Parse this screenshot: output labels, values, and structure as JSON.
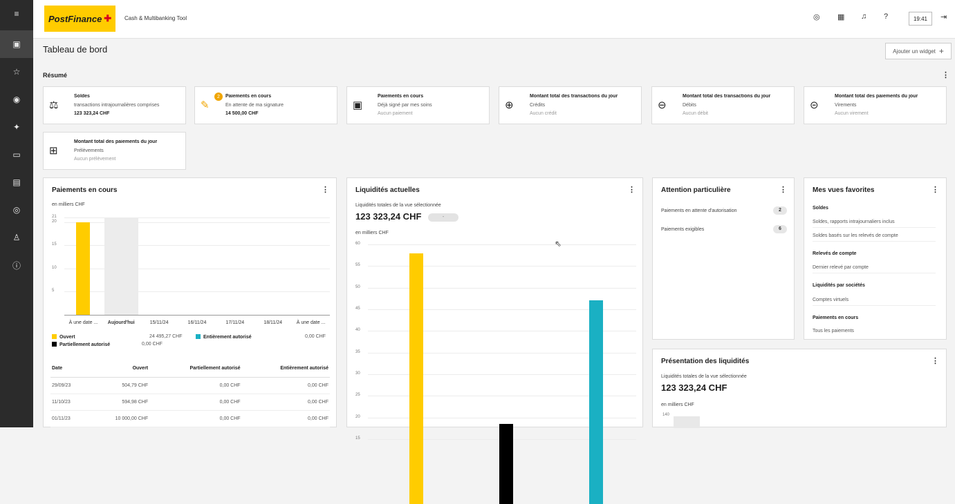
{
  "topbar": {
    "brand": "PostFinance",
    "app_title": "Cash & Multibanking Tool",
    "time": "19:41",
    "icons": [
      "user-circle-icon",
      "calculator-icon",
      "bell-icon",
      "help-icon",
      "logout-icon"
    ]
  },
  "sidebar": {
    "items": [
      "menu-icon",
      "dashboard-icon",
      "star-icon",
      "payments-icon",
      "settings-icon",
      "cards-icon",
      "documents-icon",
      "accounts-icon",
      "user-icon",
      "info-icon"
    ]
  },
  "page": {
    "title": "Tableau de bord",
    "add_widget": "Ajouter un widget",
    "add_icon": "+"
  },
  "summary": {
    "title": "Résumé",
    "cards": [
      {
        "title": "Soldes",
        "sub": "transactions intrajournalières comprises",
        "value": "123 323,24 CHF",
        "icon": "scale-icon"
      },
      {
        "title": "Paiements en cours",
        "sub": "En attente de ma signature",
        "value": "14 500,00 CHF",
        "badge": "2",
        "icon": "signature-icon"
      },
      {
        "title": "Paiements en cours",
        "sub": "Déjà signé par mes soins",
        "value": "Aucun paiement",
        "icon": "money-check-icon"
      },
      {
        "title": "Montant total des transactions du jour",
        "sub": "Crédits",
        "value": "Aucun crédit",
        "icon": "credit-doc-icon"
      },
      {
        "title": "Montant total des transactions du jour",
        "sub": "Débits",
        "value": "Aucun débit",
        "icon": "debit-doc-icon"
      },
      {
        "title": "Montant total des paiements du jour",
        "sub": "Virements",
        "value": "Aucun virement",
        "icon": "transfer-minus-icon"
      },
      {
        "title": "Montant total des paiements du jour",
        "sub": "Prélèvements",
        "value": "Aucun prélèvement",
        "icon": "transfer-plus-icon"
      }
    ]
  },
  "payments_widget": {
    "title": "Paiements en cours",
    "unit": "en milliers CHF",
    "legend": [
      {
        "label": "Ouvert",
        "value": "24 495,27 CHF",
        "color": "#ffcc00"
      },
      {
        "label": "Entièrement autorisé",
        "value": "0,00 CHF",
        "color": "#1ab0c3"
      },
      {
        "label": "Partiellement autorisé",
        "value": "0,00 CHF",
        "color": "#000000"
      }
    ],
    "table": {
      "headers": [
        "Date",
        "Ouvert",
        "Partiellement autorisé",
        "Entièrement autorisé"
      ],
      "rows": [
        [
          "29/09/23",
          "504,79 CHF",
          "0,00 CHF",
          "0,00 CHF"
        ],
        [
          "11/10/23",
          "594,98 CHF",
          "0,00 CHF",
          "0,00 CHF"
        ],
        [
          "01/11/23",
          "10 000,00 CHF",
          "0,00 CHF",
          "0,00 CHF"
        ]
      ]
    }
  },
  "liquidity_widget": {
    "title": "Liquidités actuelles",
    "sub": "Liquidités totales de la vue sélectionnée",
    "amount": "123 323,24 CHF",
    "pill": "-",
    "unit": "en milliers CHF"
  },
  "attention_widget": {
    "title": "Attention particulière",
    "rows": [
      {
        "label": "Paiements en attente d'autorisation",
        "count": "2"
      },
      {
        "label": "Paiements exigibles",
        "count": "6"
      }
    ]
  },
  "favorites_widget": {
    "title": "Mes vues favorites",
    "groups": [
      {
        "heading": "Soldes",
        "links": [
          "Soldes, rapports intrajournaliers inclus",
          "Soldes basés sur les relevés de compte"
        ]
      },
      {
        "heading": "Relevés de compte",
        "links": [
          "Dernier relevé par compte"
        ]
      },
      {
        "heading": "Liquidités par sociétés",
        "links": [
          "Comptes virtuels"
        ]
      },
      {
        "heading": "Paiements en cours",
        "links": [
          "Tous les paiements"
        ]
      }
    ]
  },
  "overview_widget": {
    "title": "Présentation des liquidités",
    "sub": "Liquidités totales de la vue sélectionnée",
    "amount": "123 323,24 CHF",
    "unit": "en milliers CHF",
    "tick_top": "140"
  },
  "chart_data": [
    {
      "type": "bar",
      "title": "Paiements en cours",
      "ylabel": "en milliers CHF",
      "ylim": [
        0,
        21
      ],
      "yticks": [
        "21",
        "20",
        "15",
        "10",
        "5"
      ],
      "categories": [
        "À une date ...",
        "Aujourd'hui",
        "15/11/24",
        "16/11/24",
        "17/11/24",
        "18/11/24",
        "À une date ..."
      ],
      "series": [
        {
          "name": "Ouvert",
          "color": "#ffcc00",
          "values": [
            20,
            null,
            null,
            null,
            null,
            null,
            null
          ]
        }
      ],
      "highlight_category": "Aujourd'hui"
    },
    {
      "type": "bar",
      "title": "Liquidités actuelles",
      "ylabel": "en milliers CHF",
      "ylim": [
        0,
        60
      ],
      "yticks": [
        "60",
        "55",
        "50",
        "45",
        "40",
        "35",
        "30",
        "25",
        "20",
        "15"
      ],
      "values": [
        58,
        18.5,
        47
      ],
      "colors": [
        "#ffcc00",
        "#000000",
        "#1ab0c3"
      ]
    }
  ]
}
